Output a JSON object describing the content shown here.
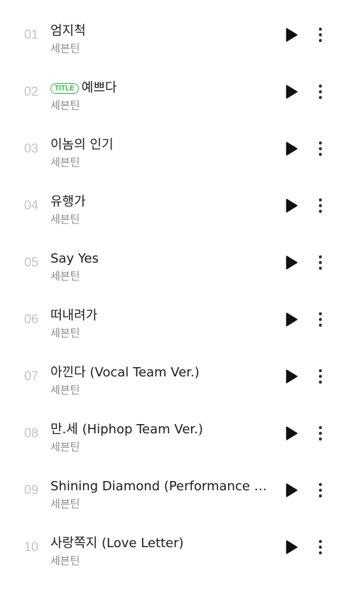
{
  "tracks": [
    {
      "number": "01",
      "title": "엄지척",
      "artist": "세븐틴",
      "badge": ""
    },
    {
      "number": "02",
      "title": "예쁘다",
      "artist": "세븐틴",
      "badge": "TITLE"
    },
    {
      "number": "03",
      "title": "이놈의 인기",
      "artist": "세븐틴",
      "badge": ""
    },
    {
      "number": "04",
      "title": "유행가",
      "artist": "세븐틴",
      "badge": ""
    },
    {
      "number": "05",
      "title": "Say Yes",
      "artist": "세븐틴",
      "badge": ""
    },
    {
      "number": "06",
      "title": "떠내려가",
      "artist": "세븐틴",
      "badge": ""
    },
    {
      "number": "07",
      "title": "아낀다 (Vocal Team Ver.)",
      "artist": "세븐틴",
      "badge": ""
    },
    {
      "number": "08",
      "title": "만.세 (Hiphop Team Ver.)",
      "artist": "세븐틴",
      "badge": ""
    },
    {
      "number": "09",
      "title": "Shining Diamond (Performance T...",
      "artist": "세븐틴",
      "badge": ""
    },
    {
      "number": "10",
      "title": "사랑쪽지 (Love Letter)",
      "artist": "세븐틴",
      "badge": ""
    }
  ],
  "icons": {
    "play": "play-icon",
    "more": "more-vertical-icon"
  },
  "colors": {
    "title_text": "#1c1c1c",
    "artist_text": "#8a8a8a",
    "track_number": "#c4c4c4",
    "badge_accent": "#1fc23a",
    "icon": "#111111"
  }
}
